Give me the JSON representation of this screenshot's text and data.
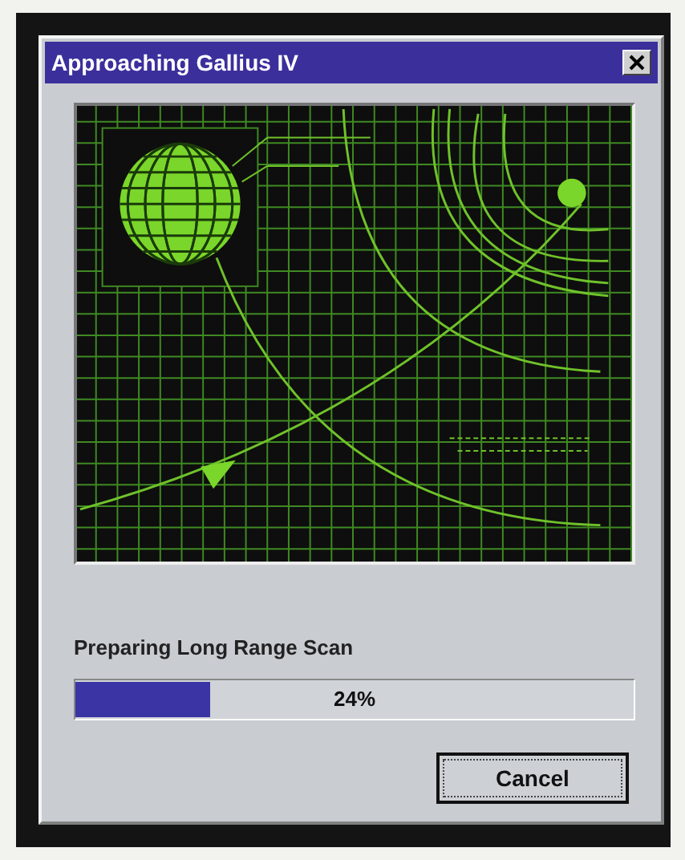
{
  "window": {
    "title": "Approaching Gallius IV"
  },
  "progress": {
    "label": "Preparing Long Range Scan",
    "level": 0.24,
    "reading": "24%"
  },
  "buttons": [
    "Cancel"
  ]
}
